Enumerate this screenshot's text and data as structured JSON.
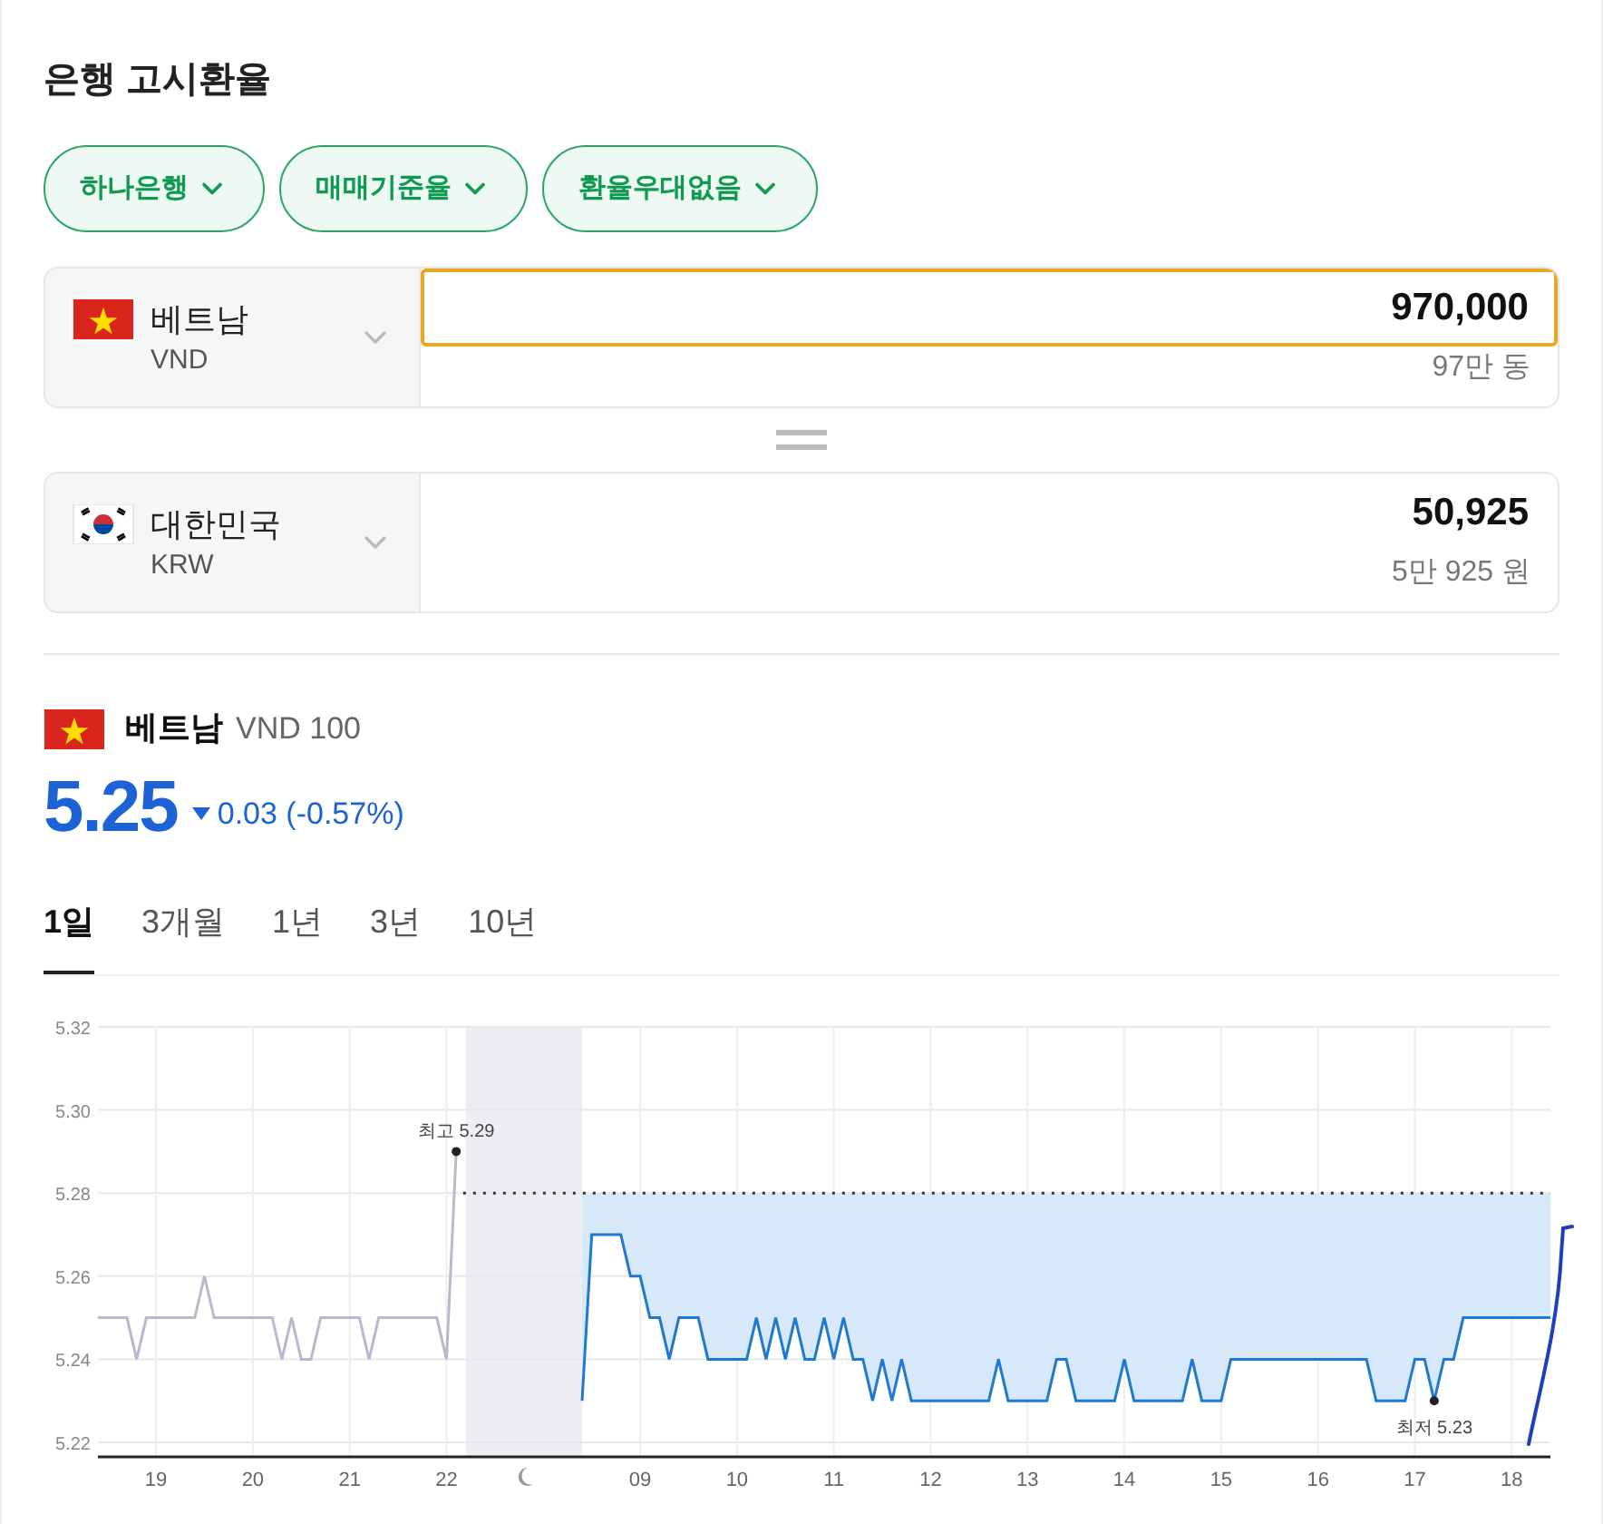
{
  "title": "은행 고시환율",
  "filters": [
    {
      "label": "하나은행"
    },
    {
      "label": "매매기준율"
    },
    {
      "label": "환율우대없음"
    }
  ],
  "converter": [
    {
      "kind": "vietnam",
      "country": "베트남",
      "code": "VND",
      "value": "970,000",
      "reading": "97만 동",
      "focused": true
    },
    {
      "kind": "korea",
      "country": "대한민국",
      "code": "KRW",
      "value": "50,925",
      "reading": "5만 925 원",
      "focused": false
    }
  ],
  "quote": {
    "kind": "vietnam",
    "country": "베트남",
    "unit": "VND 100",
    "rate": "5.25",
    "falling": true,
    "change": "0.03 (-0.57%)"
  },
  "periods": [
    {
      "label": "1일",
      "selected": true
    },
    {
      "label": "3개월",
      "selected": false
    },
    {
      "label": "1년",
      "selected": false
    },
    {
      "label": "3년",
      "selected": false
    },
    {
      "label": "10년",
      "selected": false
    }
  ],
  "chart_data": {
    "type": "line",
    "categories": [
      null,
      null,
      null,
      null,
      null,
      null,
      "19",
      null,
      null,
      null,
      null,
      null,
      null,
      null,
      null,
      null,
      "20",
      null,
      null,
      null,
      null,
      null,
      null,
      null,
      null,
      null,
      "21",
      null,
      null,
      null,
      null,
      null,
      null,
      null,
      null,
      null,
      "22",
      null,
      null,
      null,
      null,
      null,
      null,
      null,
      null,
      null,
      null,
      null,
      null,
      null,
      null,
      null,
      null,
      null,
      null,
      null,
      "09",
      null,
      null,
      null,
      null,
      null,
      null,
      null,
      null,
      null,
      "10",
      null,
      null,
      null,
      null,
      null,
      null,
      null,
      null,
      null,
      "11",
      null,
      null,
      null,
      null,
      null,
      null,
      null,
      null,
      null,
      "12",
      null,
      null,
      null,
      null,
      null,
      null,
      null,
      null,
      null,
      "13",
      null,
      null,
      null,
      null,
      null,
      null,
      null,
      null,
      null,
      "14",
      null,
      null,
      null,
      null,
      null,
      null,
      null,
      null,
      null,
      "15",
      null,
      null,
      null,
      null,
      null,
      null,
      null,
      null,
      null,
      "16",
      null,
      null,
      null,
      null,
      null,
      null,
      null,
      null,
      null,
      "17",
      null,
      null,
      null,
      null,
      null,
      null,
      null,
      null,
      null,
      "18",
      null,
      null,
      null,
      null
    ],
    "series": [
      {
        "color": "#b9b9cc",
        "values": [
          5.25,
          5.25,
          5.25,
          5.25,
          5.24,
          5.25,
          5.25,
          5.25,
          5.25,
          5.25,
          5.25,
          5.26,
          5.25,
          5.25,
          5.25,
          5.25,
          5.25,
          5.25,
          5.25,
          5.24,
          5.25,
          5.24,
          5.24,
          5.25,
          5.25,
          5.25,
          5.25,
          5.25,
          5.24,
          5.25,
          5.25,
          5.25,
          5.25,
          5.25,
          5.25,
          5.25,
          5.24,
          5.29,
          null,
          null,
          null,
          null,
          null,
          null,
          null,
          null,
          null,
          null,
          null,
          null,
          null,
          null,
          null,
          null,
          null,
          null,
          null,
          null,
          null,
          null,
          null,
          null,
          null,
          null,
          null,
          null,
          null,
          null,
          null,
          null,
          null,
          null,
          null,
          null,
          null,
          null,
          null,
          null,
          null,
          null,
          null,
          null,
          null,
          null,
          null,
          null,
          null,
          null,
          null,
          null,
          null,
          null,
          null,
          null,
          null,
          null,
          null,
          null,
          null,
          null,
          null,
          null,
          null,
          null,
          null,
          null,
          null,
          null,
          null,
          null,
          null,
          null,
          null,
          null,
          null,
          null,
          null,
          null,
          null,
          null,
          null,
          null,
          null,
          null,
          null,
          null,
          null,
          null,
          null,
          null,
          null,
          null,
          null,
          null,
          null,
          null,
          null,
          null,
          null,
          null,
          null,
          null,
          null,
          null,
          null,
          null,
          null,
          null,
          null,
          null,
          null
        ]
      },
      {
        "color": "#1f78d1",
        "values": [
          null,
          null,
          null,
          null,
          null,
          null,
          null,
          null,
          null,
          null,
          null,
          null,
          null,
          null,
          null,
          null,
          null,
          null,
          null,
          null,
          null,
          null,
          null,
          null,
          null,
          null,
          null,
          null,
          null,
          null,
          null,
          null,
          null,
          null,
          null,
          null,
          null,
          null,
          null,
          null,
          null,
          null,
          null,
          null,
          null,
          null,
          null,
          null,
          null,
          null,
          5.23,
          5.27,
          5.27,
          5.27,
          5.27,
          5.26,
          5.26,
          5.25,
          5.25,
          5.24,
          5.25,
          5.25,
          5.25,
          5.24,
          5.24,
          5.24,
          5.24,
          5.24,
          5.25,
          5.24,
          5.25,
          5.24,
          5.25,
          5.24,
          5.24,
          5.25,
          5.24,
          5.25,
          5.24,
          5.24,
          5.23,
          5.24,
          5.23,
          5.24,
          5.23,
          5.23,
          5.23,
          5.23,
          5.23,
          5.23,
          5.23,
          5.23,
          5.23,
          5.24,
          5.23,
          5.23,
          5.23,
          5.23,
          5.23,
          5.24,
          5.24,
          5.23,
          5.23,
          5.23,
          5.23,
          5.23,
          5.24,
          5.23,
          5.23,
          5.23,
          5.23,
          5.23,
          5.23,
          5.24,
          5.23,
          5.23,
          5.23,
          5.24,
          5.24,
          5.24,
          5.24,
          5.24,
          5.24,
          5.24,
          5.24,
          5.24,
          5.24,
          5.24,
          5.24,
          5.24,
          5.24,
          5.24,
          5.23,
          5.23,
          5.23,
          5.23,
          5.24,
          5.24,
          5.23,
          5.24,
          5.24,
          5.25,
          5.25,
          5.25,
          5.25,
          5.25,
          5.25,
          5.25,
          5.25,
          5.25,
          5.25
        ]
      }
    ],
    "ylim": [
      5.22,
      5.32
    ],
    "yticks": [
      {
        "value": 5.22,
        "label": "5.22"
      },
      {
        "value": 5.24,
        "label": "5.24"
      },
      {
        "value": 5.26,
        "label": "5.26"
      },
      {
        "value": 5.28,
        "label": "5.28"
      },
      {
        "value": 5.3,
        "label": "5.30"
      },
      {
        "value": 5.32,
        "label": "5.32"
      }
    ],
    "grid": true,
    "ref_lines": [
      {
        "axis": "y",
        "value": 5.28
      }
    ],
    "annotations": [
      {
        "y": 5.29,
        "text": "최고 5.29"
      },
      {
        "y": 5.23,
        "text": "최저 5.23"
      }
    ]
  }
}
